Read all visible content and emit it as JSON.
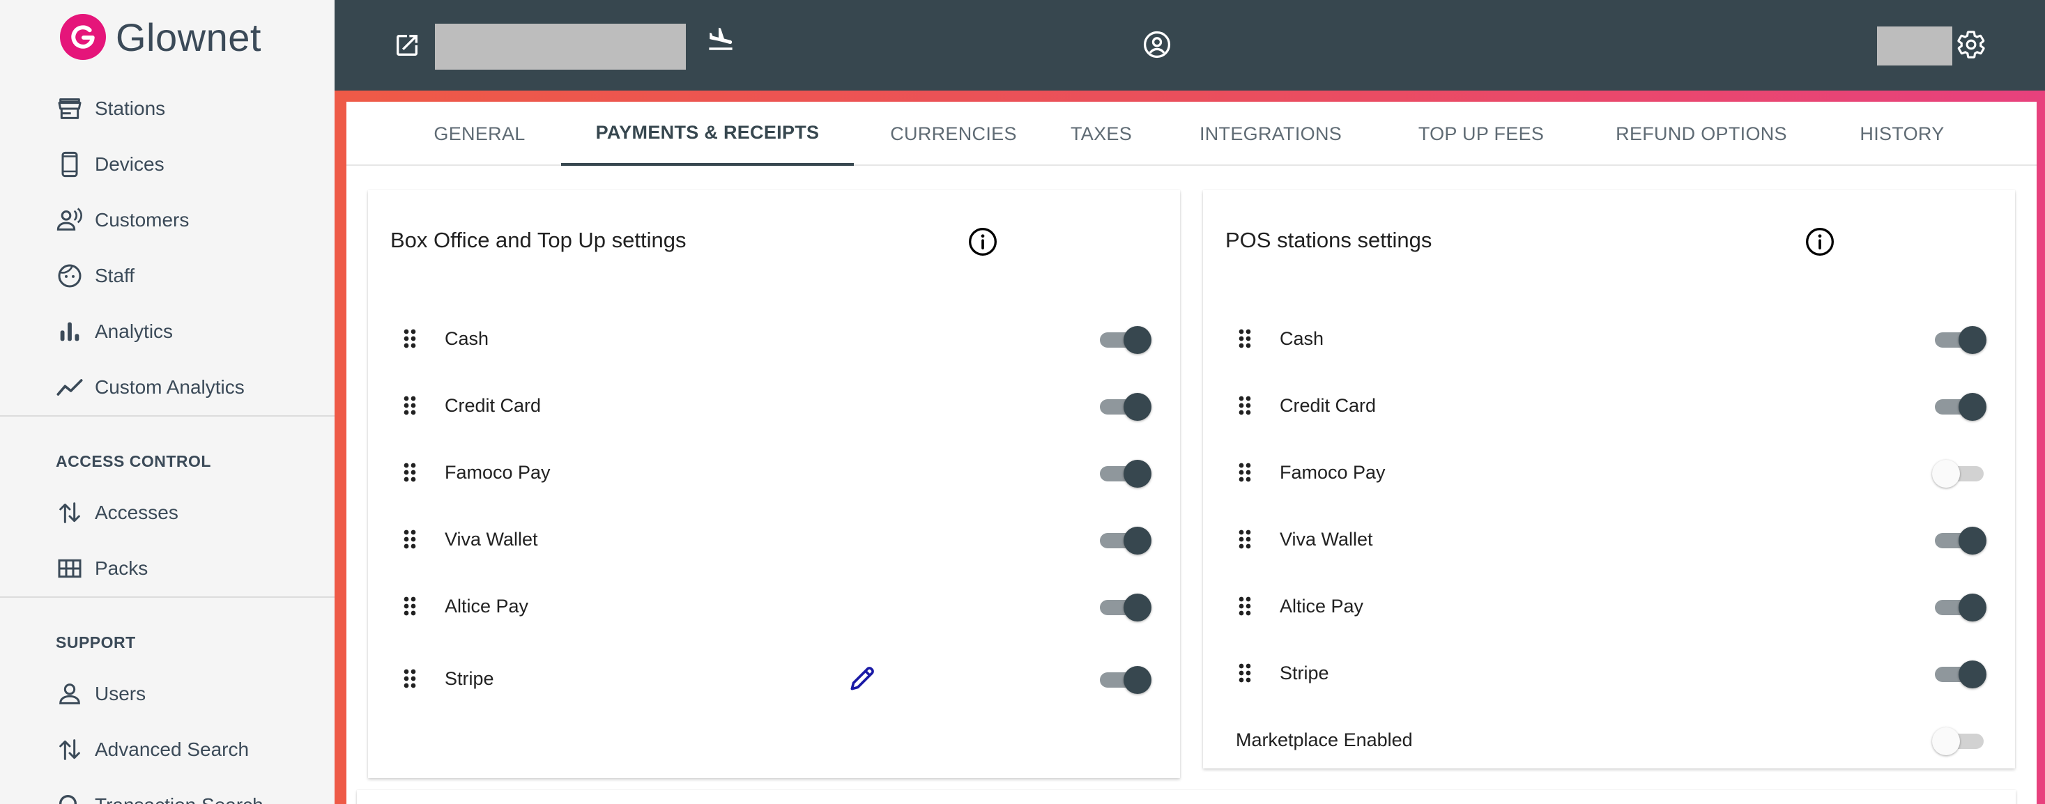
{
  "brand": {
    "name": "Glownet",
    "logo_letter": "G",
    "color": "#e5157a"
  },
  "sidebar": {
    "items": [
      {
        "label": "Stations",
        "icon": "store-icon"
      },
      {
        "label": "Devices",
        "icon": "phone-icon"
      },
      {
        "label": "Customers",
        "icon": "customer-voice-icon"
      },
      {
        "label": "Staff",
        "icon": "face-icon"
      },
      {
        "label": "Analytics",
        "icon": "bar-chart-icon"
      },
      {
        "label": "Custom Analytics",
        "icon": "line-chart-icon"
      }
    ],
    "access_control": {
      "heading": "ACCESS CONTROL",
      "items": [
        {
          "label": "Accesses",
          "icon": "swap-vertical-icon"
        },
        {
          "label": "Packs",
          "icon": "grid-icon"
        }
      ]
    },
    "support": {
      "heading": "SUPPORT",
      "items": [
        {
          "label": "Users",
          "icon": "user-icon"
        },
        {
          "label": "Advanced Search",
          "icon": "swap-vertical-icon"
        },
        {
          "label": "Transaction Search",
          "icon": "search-icon"
        }
      ]
    }
  },
  "topbar": {
    "icons": [
      "open-external-icon",
      "flight-land-icon",
      "account-circle-icon",
      "gear-icon"
    ],
    "background": "#37474f"
  },
  "tabs": [
    {
      "label": "GENERAL",
      "active": false
    },
    {
      "label": "PAYMENTS & RECEIPTS",
      "active": true
    },
    {
      "label": "CURRENCIES",
      "active": false
    },
    {
      "label": "TAXES",
      "active": false
    },
    {
      "label": "INTEGRATIONS",
      "active": false
    },
    {
      "label": "TOP UP FEES",
      "active": false
    },
    {
      "label": "REFUND OPTIONS",
      "active": false
    },
    {
      "label": "HISTORY",
      "active": false
    }
  ],
  "box_office": {
    "title": "Box Office and Top Up settings",
    "methods": [
      {
        "label": "Cash",
        "enabled": true
      },
      {
        "label": "Credit Card",
        "enabled": true
      },
      {
        "label": "Famoco Pay",
        "enabled": true
      },
      {
        "label": "Viva Wallet",
        "enabled": true
      },
      {
        "label": "Altice Pay",
        "enabled": true
      },
      {
        "label": "Stripe",
        "enabled": true,
        "editable": true
      }
    ]
  },
  "pos": {
    "title": "POS stations settings",
    "methods": [
      {
        "label": "Cash",
        "enabled": true
      },
      {
        "label": "Credit Card",
        "enabled": true
      },
      {
        "label": "Famoco Pay",
        "enabled": false
      },
      {
        "label": "Viva Wallet",
        "enabled": true
      },
      {
        "label": "Altice Pay",
        "enabled": true
      },
      {
        "label": "Stripe",
        "enabled": true
      }
    ],
    "marketplace": {
      "label": "Marketplace Enabled",
      "enabled": false
    }
  }
}
